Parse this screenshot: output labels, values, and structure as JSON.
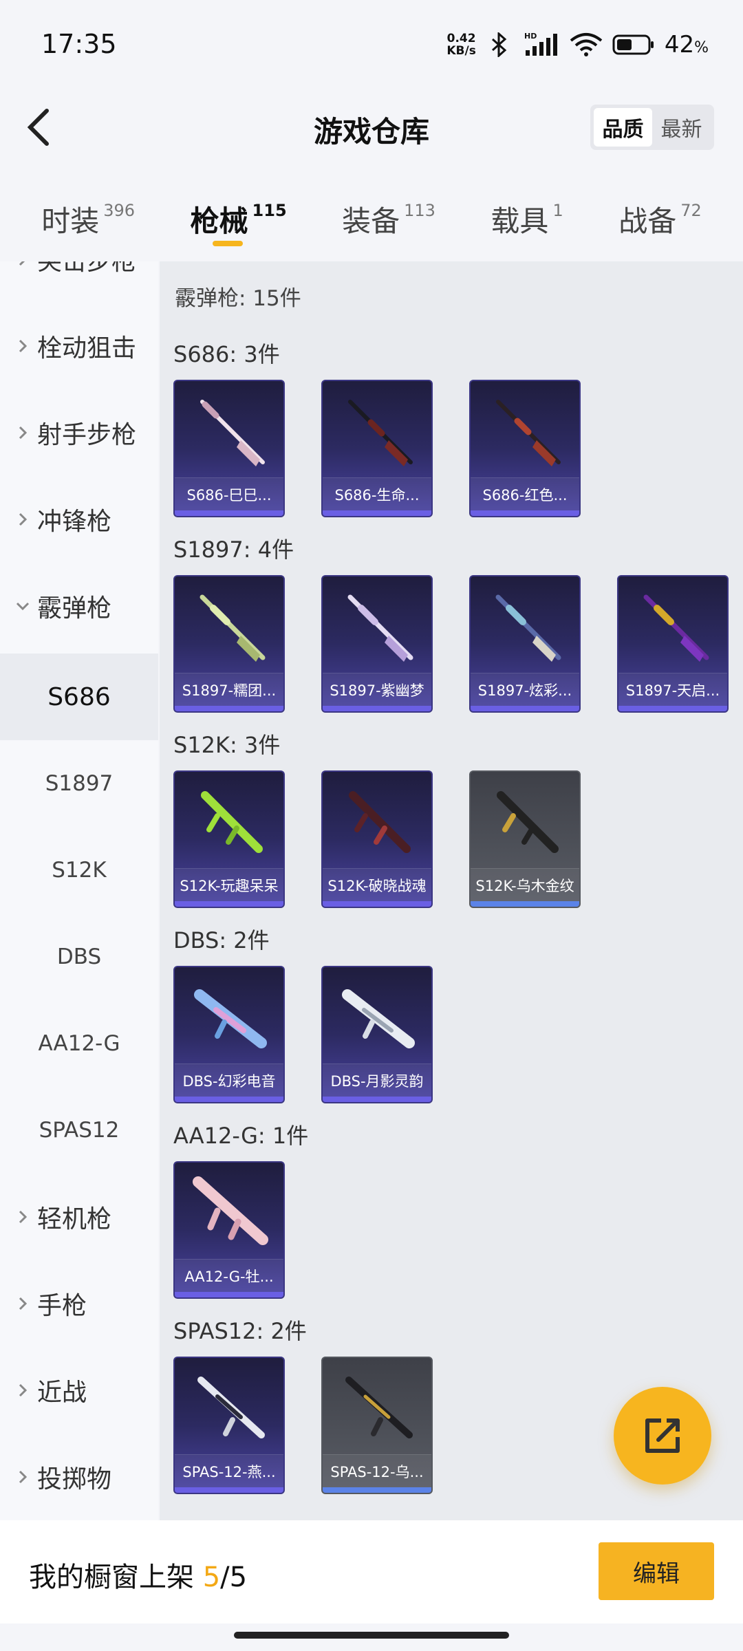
{
  "status_bar": {
    "time": "17:35",
    "net_speed_value": "0.42",
    "net_speed_unit": "KB/s",
    "hd_label": "HD",
    "battery_percent": "42",
    "battery_unit": "%"
  },
  "header": {
    "title": "游戏仓库",
    "sort_options": [
      "品质",
      "最新"
    ],
    "sort_selected": "品质"
  },
  "tabs": [
    {
      "label": "时装",
      "count": "396"
    },
    {
      "label": "枪械",
      "count": "115"
    },
    {
      "label": "装备",
      "count": "113"
    },
    {
      "label": "载具",
      "count": "1"
    },
    {
      "label": "战备",
      "count": "72"
    }
  ],
  "active_tab": "枪械",
  "sidebar": {
    "partial_top": "突击步枪",
    "categories": [
      "栓动狙击",
      "射手步枪",
      "冲锋枪",
      "霰弹枪"
    ],
    "expanded": "霰弹枪",
    "subcategories": [
      "S686",
      "S1897",
      "S12K",
      "DBS",
      "AA12-G",
      "SPAS12"
    ],
    "selected_sub": "S686",
    "categories_after": [
      "轻机枪",
      "手枪",
      "近战",
      "投掷物"
    ]
  },
  "content": {
    "header": "霰弹枪: 15件",
    "groups": [
      {
        "title": "S686: 3件",
        "items": [
          {
            "name": "S686-巳巳...",
            "quality": "purple"
          },
          {
            "name": "S686-生命...",
            "quality": "purple"
          },
          {
            "name": "S686-红色...",
            "quality": "purple"
          }
        ]
      },
      {
        "title": "S1897: 4件",
        "items": [
          {
            "name": "S1897-糯团...",
            "quality": "purple"
          },
          {
            "name": "S1897-紫幽梦",
            "quality": "purple"
          },
          {
            "name": "S1897-炫彩...",
            "quality": "purple"
          },
          {
            "name": "S1897-天启...",
            "quality": "purple"
          }
        ]
      },
      {
        "title": "S12K: 3件",
        "items": [
          {
            "name": "S12K-玩趣呆呆",
            "quality": "purple"
          },
          {
            "name": "S12K-破晓战魂",
            "quality": "purple"
          },
          {
            "name": "S12K-乌木金纹",
            "quality": "grey"
          }
        ]
      },
      {
        "title": "DBS: 2件",
        "items": [
          {
            "name": "DBS-幻彩电音",
            "quality": "purple"
          },
          {
            "name": "DBS-月影灵韵",
            "quality": "purple"
          }
        ]
      },
      {
        "title": "AA12-G: 1件",
        "items": [
          {
            "name": "AA12-G-牡...",
            "quality": "purple"
          }
        ]
      },
      {
        "title": "SPAS12: 2件",
        "items": [
          {
            "name": "SPAS-12-燕...",
            "quality": "purple"
          },
          {
            "name": "SPAS-12-乌...",
            "quality": "grey"
          }
        ]
      }
    ]
  },
  "bottom_bar": {
    "label": "我的橱窗上架",
    "current": "5",
    "separator": "/",
    "total": "5",
    "edit_label": "编辑"
  },
  "colors": {
    "accent": "#f6b322",
    "card_purple": "#2c2a61",
    "card_grey": "#4d5058"
  }
}
